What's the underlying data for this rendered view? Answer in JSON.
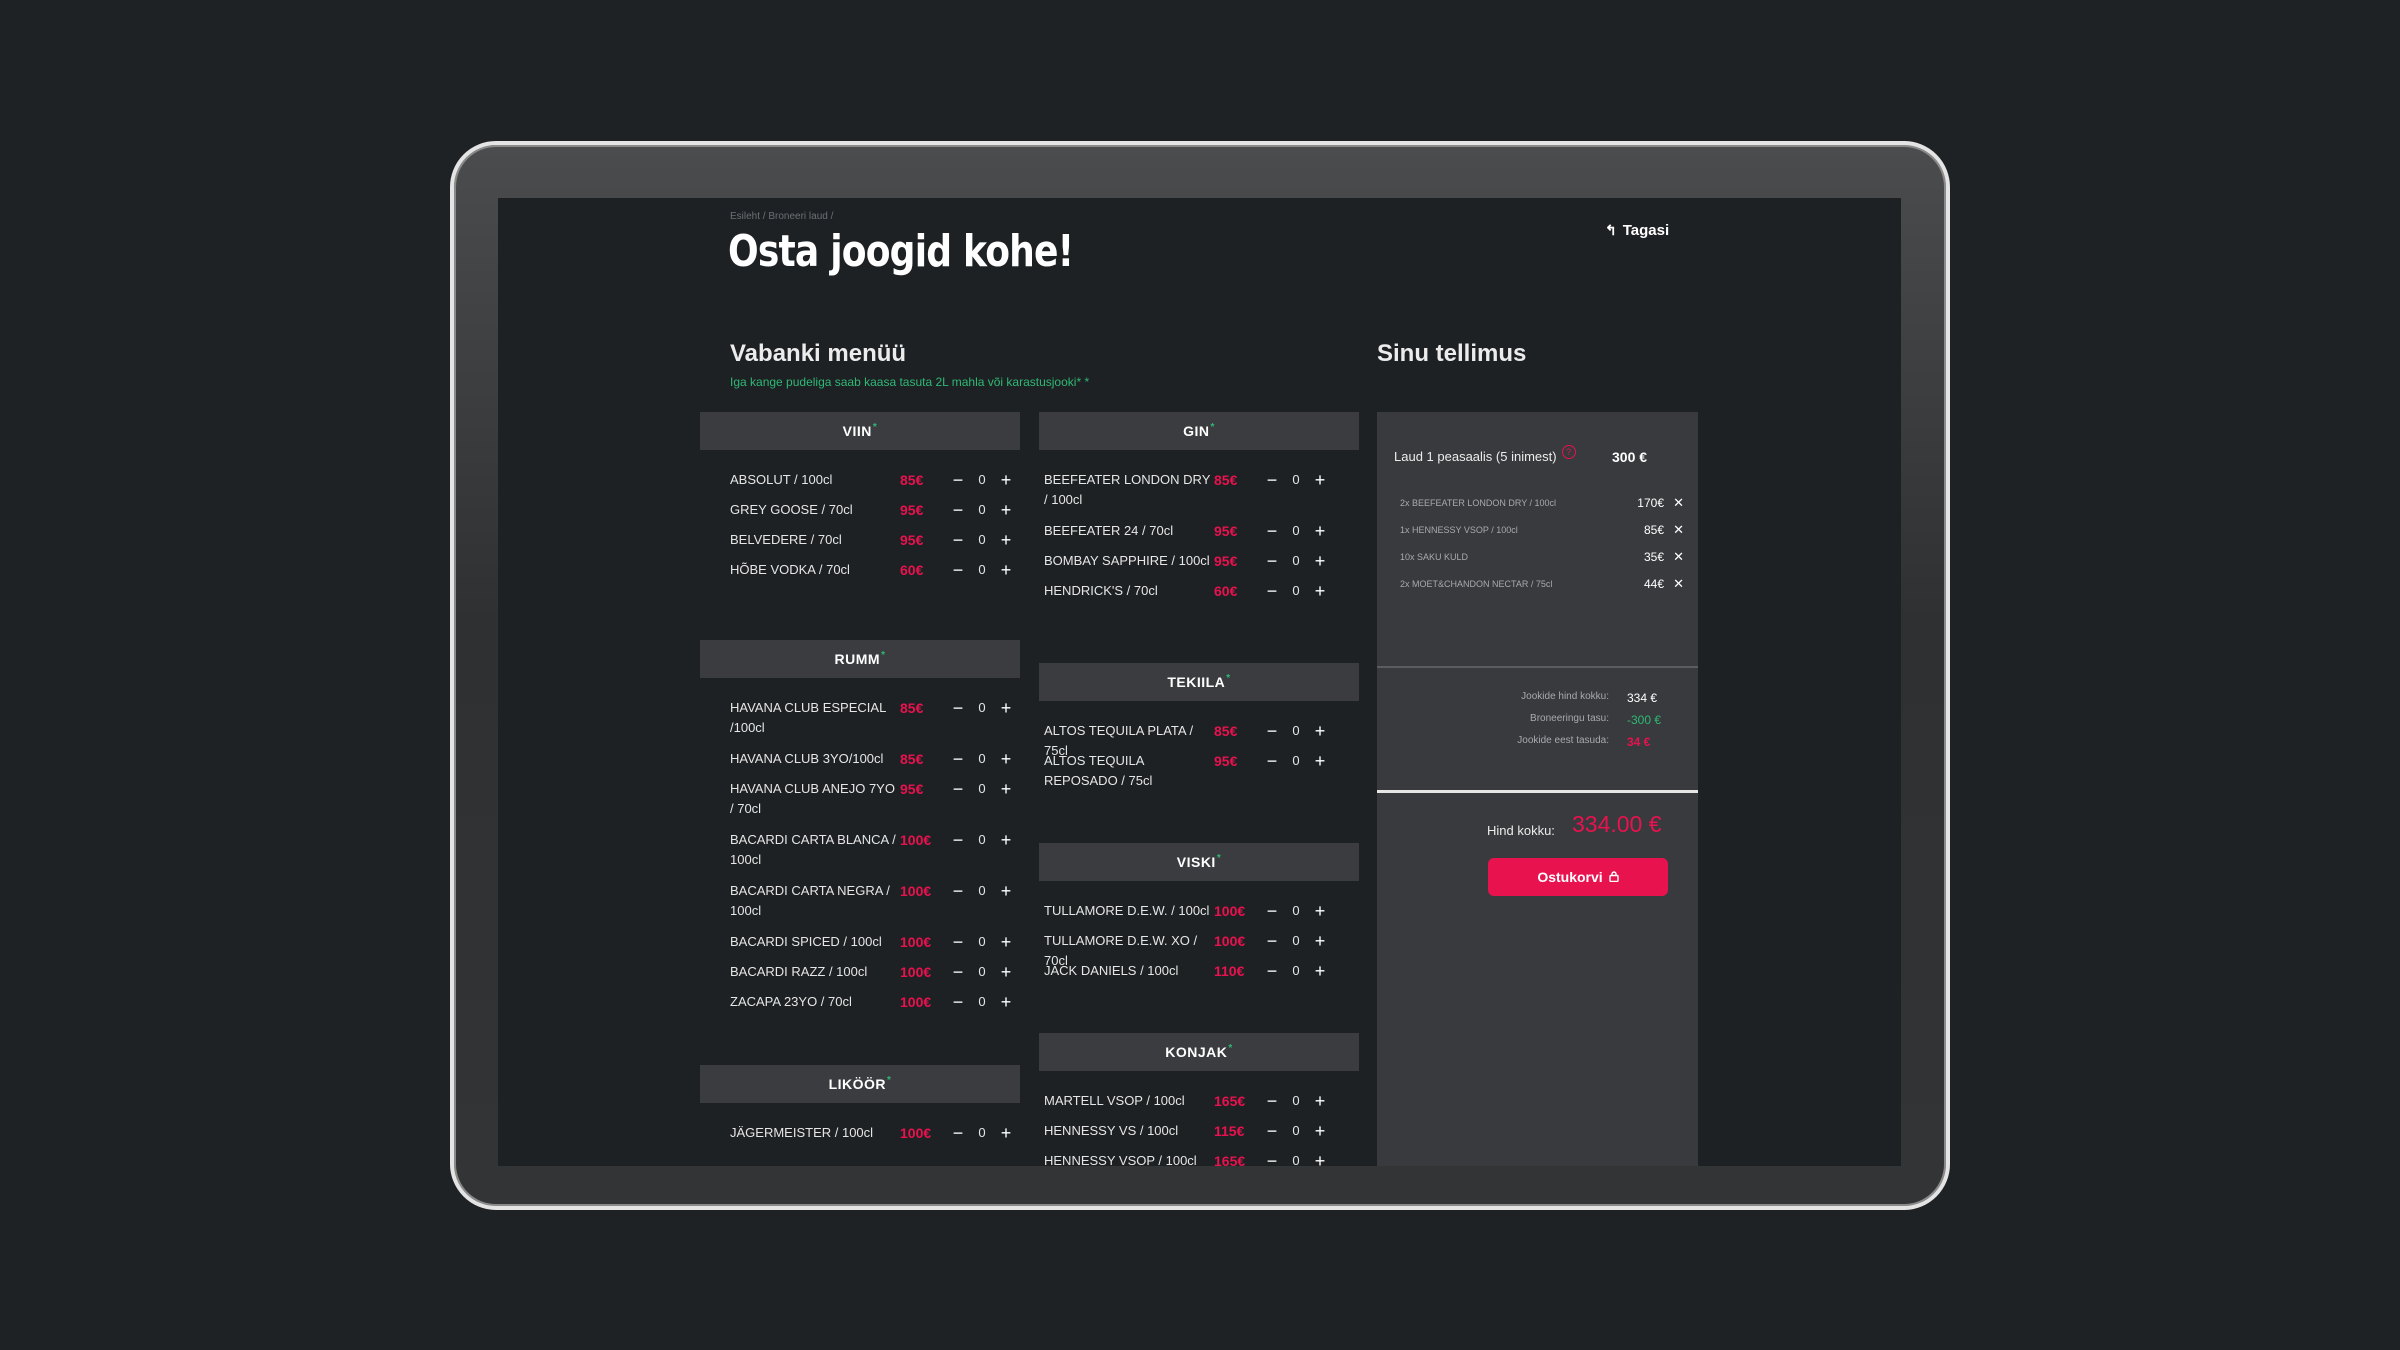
{
  "breadcrumb": "Esileht / Broneeri laud /",
  "title": "Osta joogid kohe!",
  "back_label": "Tagasi",
  "menu_title": "Vabanki menüü",
  "menu_note": "Iga kange pudeliga saab kaasa tasuta 2L mahla või karastusjooki* *",
  "order_title": "Sinu tellimus",
  "colors": {
    "accent": "#e8124f",
    "green": "#2fb874",
    "background": "#1e2124",
    "panel": "#383a3d"
  },
  "categories": {
    "viin": {
      "name": "VIIN",
      "products": [
        {
          "name": "ABSOLUT / 100cl",
          "price": "85€",
          "qty": "0"
        },
        {
          "name": "GREY GOOSE / 70cl",
          "price": "95€",
          "qty": "0"
        },
        {
          "name": "BELVEDERE / 70cl",
          "price": "95€",
          "qty": "0"
        },
        {
          "name": "HÕBE VODKA / 70cl",
          "price": "60€",
          "qty": "0"
        }
      ]
    },
    "rumm": {
      "name": "RUMM",
      "products": [
        {
          "name": "HAVANA CLUB ESPECIAL /100cl",
          "price": "85€",
          "qty": "0"
        },
        {
          "name": "HAVANA CLUB 3YO/100cl",
          "price": "85€",
          "qty": "0"
        },
        {
          "name": "HAVANA CLUB ANEJO 7YO / 70cl",
          "price": "95€",
          "qty": "0"
        },
        {
          "name": "BACARDI CARTA BLANCA / 100cl",
          "price": "100€",
          "qty": "0"
        },
        {
          "name": "BACARDI CARTA NEGRA / 100cl",
          "price": "100€",
          "qty": "0"
        },
        {
          "name": "BACARDI SPICED / 100cl",
          "price": "100€",
          "qty": "0"
        },
        {
          "name": "BACARDI RAZZ / 100cl",
          "price": "100€",
          "qty": "0"
        },
        {
          "name": "ZACAPA 23YO / 70cl",
          "price": "100€",
          "qty": "0"
        }
      ]
    },
    "likoor": {
      "name": "LIKÖÖR",
      "products": [
        {
          "name": "JÄGERMEISTER / 100cl",
          "price": "100€",
          "qty": "0"
        }
      ]
    },
    "gin": {
      "name": "GIN",
      "products": [
        {
          "name": "BEEFEATER LONDON DRY / 100cl",
          "price": "85€",
          "qty": "0"
        },
        {
          "name": "BEEFEATER 24 / 70cl",
          "price": "95€",
          "qty": "0"
        },
        {
          "name": "BOMBAY SAPPHIRE / 100cl",
          "price": "95€",
          "qty": "0"
        },
        {
          "name": "HENDRICK'S / 70cl",
          "price": "60€",
          "qty": "0"
        }
      ]
    },
    "tekiila": {
      "name": "TEKIILA",
      "products": [
        {
          "name": "ALTOS TEQUILA PLATA / 75cl",
          "price": "85€",
          "qty": "0"
        },
        {
          "name": "ALTOS TEQUILA REPOSADO / 75cl",
          "price": "95€",
          "qty": "0"
        }
      ]
    },
    "viski": {
      "name": "VISKI",
      "products": [
        {
          "name": "TULLAMORE D.E.W. / 100cl",
          "price": "100€",
          "qty": "0"
        },
        {
          "name": "TULLAMORE D.E.W. XO / 70cl",
          "price": "100€",
          "qty": "0"
        },
        {
          "name": "JACK DANIELS / 100cl",
          "price": "110€",
          "qty": "0"
        }
      ]
    },
    "konjak": {
      "name": "KONJAK",
      "products": [
        {
          "name": "MARTELL VSOP / 100cl",
          "price": "165€",
          "qty": "0"
        },
        {
          "name": "HENNESSY VS / 100cl",
          "price": "115€",
          "qty": "0"
        },
        {
          "name": "HENNESSY VSOP / 100cl",
          "price": "165€",
          "qty": "0"
        }
      ]
    }
  },
  "order": {
    "table_label": "Laud 1 peasaalis (5 inimest)",
    "table_price": "300 €",
    "items": [
      {
        "name": "2x BEEFEATER LONDON DRY / 100cl",
        "price": "170€"
      },
      {
        "name": "1x HENNESSY VSOP / 100cl",
        "price": "85€"
      },
      {
        "name": "10x SAKU KULD",
        "price": "35€"
      },
      {
        "name": "2x MOET&CHANDON NECTAR / 75cl",
        "price": "44€"
      }
    ],
    "drinks_total_label": "Jookide hind kokku:",
    "drinks_total": "334 €",
    "booking_fee_label": "Broneeringu tasu:",
    "booking_fee": "-300 €",
    "to_pay_label": "Jookide eest tasuda:",
    "to_pay": "34 €",
    "total_label": "Hind kokku:",
    "total": "334.00 €",
    "cart_label": "Ostukorvi"
  }
}
